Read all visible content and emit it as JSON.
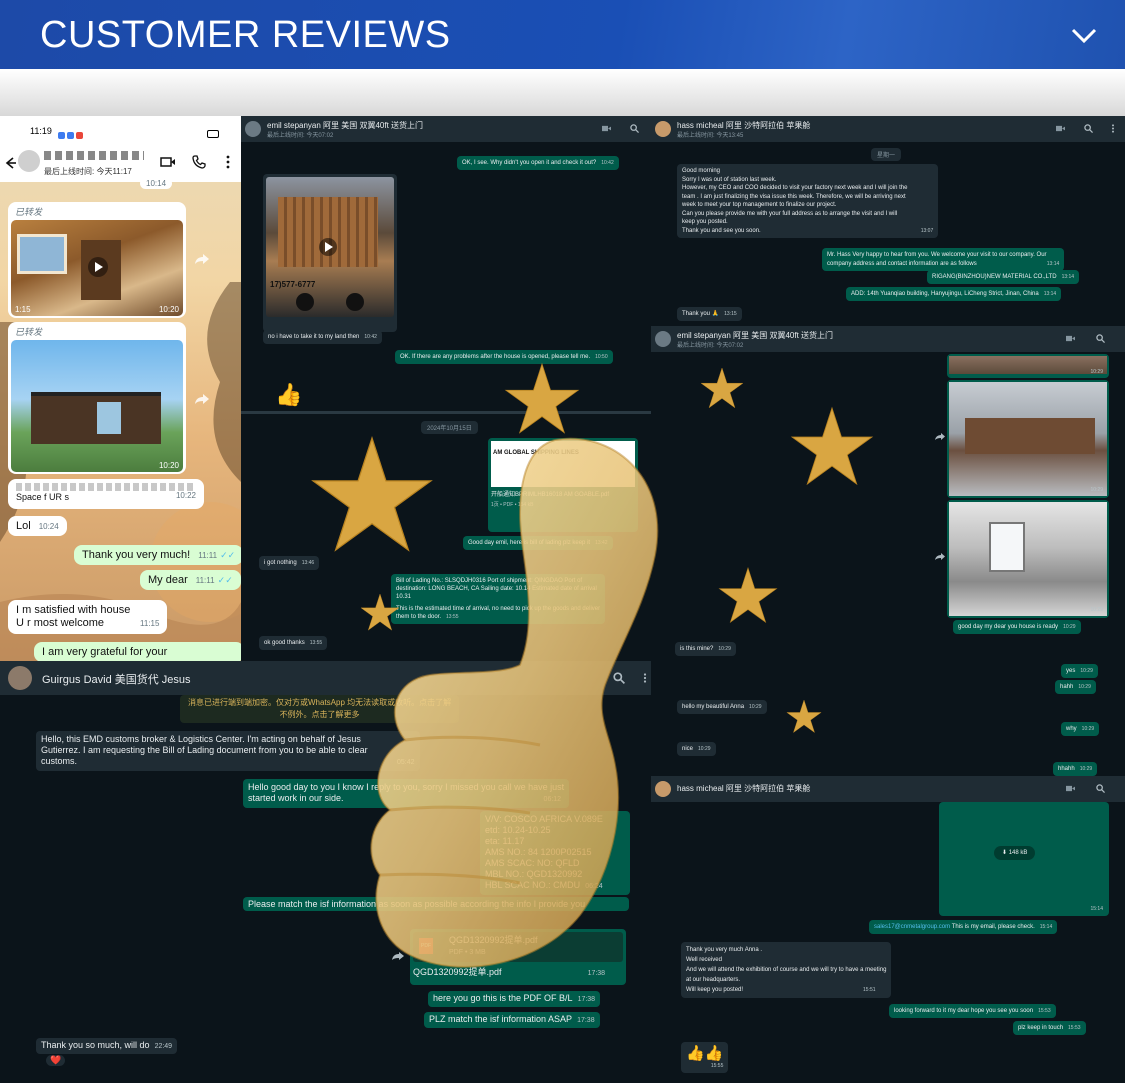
{
  "header": {
    "title": "CUSTOMER REVIEWS",
    "toggle_icon": "chevron-down-icon"
  },
  "phone": {
    "time": "11:19",
    "last_online": "最后上线时间: 今天11:17",
    "forwarded": "已转发",
    "video_duration": "1:15",
    "video_time": "10:20",
    "top_time": "10:14",
    "space_text": "Space f UR s",
    "space_time": "10:22",
    "msgs": [
      {
        "text": "Lol",
        "time": "10:24"
      },
      {
        "text": "Thank you very much!",
        "time": "11:11"
      },
      {
        "text": "My dear",
        "time": "11:11"
      },
      {
        "text": "I m  satisfied with house",
        "time": ""
      },
      {
        "text": "U r most welcome",
        "time": "11:15"
      },
      {
        "text": "I am very grateful for your",
        "time": ""
      }
    ]
  },
  "chat_emil1": {
    "name": "emil stepanyan 阿里 美国 双翼40ft 送货上门",
    "sub": "最后上线时间: 今天07:02",
    "msgs": [
      {
        "text": "OK, I see. Why didn't you open it and check it out?",
        "time": "10:42"
      },
      {
        "text": "no i have to take it to my land then",
        "time": "10:42"
      },
      {
        "text": "OK. If there are any problems after the house is opened, please tell me.",
        "time": "10:50"
      }
    ],
    "thumbs": "👍",
    "date": "2024年10月15日",
    "doc_header": "AM GLOBAL SHIPPING LINES",
    "doc_name": "开船通知BPRIMLHB16018 AM GOABLE.pdf",
    "doc_meta": "1页 • PDF • 154 kB",
    "msgs2": [
      {
        "text": "Good day emil, here is bill of lading plz keep it",
        "time": "13:42"
      },
      {
        "text": "i got nothing",
        "time": "13:46"
      },
      {
        "text": "Bill of Lading No.: SLSQDJH0316 Port of shipment: QINGDAO Port of",
        "time": ""
      },
      {
        "text": "destination: LONG BEACH, CA Sailing date: 10.14 Estimated date of arrival",
        "time": ""
      },
      {
        "text": "10.31",
        "time": ""
      },
      {
        "text": "This is the estimated time of arrival, no need to pick up the goods and deliver",
        "time": ""
      },
      {
        "text": "them to the door.",
        "time": "13:55"
      },
      {
        "text": "ok good thanks",
        "time": "13:55"
      }
    ],
    "video_phone": "17)577-6777"
  },
  "chat_hass1": {
    "name": "hass micheal 阿里 沙特阿拉伯 苹果舱",
    "sub": "最后上线时间: 今天13:45",
    "date": "星期一",
    "msgs": [
      {
        "text": "Good morning",
        "time": ""
      },
      {
        "text": "Sorry I was out of station last week.",
        "time": ""
      },
      {
        "text": "However, my CEO and COO decided to visit your factory next week and I will join the",
        "time": ""
      },
      {
        "text": "team . I am just finalizing the visa issue this week. Therefore, we will be arriving next",
        "time": ""
      },
      {
        "text": "week  to meet your top management to finalize our project.",
        "time": ""
      },
      {
        "text": "Can you please provide me with your full address as to arrange the visit and I will",
        "time": ""
      },
      {
        "text": "keep you posted.",
        "time": ""
      },
      {
        "text": "Thank you and see you soon.",
        "time": "13:07"
      }
    ],
    "replies": [
      {
        "text": "Mr. Hass Very happy to hear from you. We welcome your visit to our company. Our",
        "time": ""
      },
      {
        "text": "company address and contact information are as follows",
        "time": "13:14"
      },
      {
        "text": "RIGANG(BINZHOU)NEW MATERIAL CO.,LTD",
        "time": "13:14"
      },
      {
        "text": "ADD: 14th Yuanqiao building, Hanyujingu, LiCheng Strict, Jinan, China",
        "time": "13:14"
      }
    ],
    "thanks": {
      "text": "Thank you 🙏",
      "time": "13:15"
    }
  },
  "chat_emil2": {
    "name": "emil stepanyan 阿里 美国 双翼40ft 送货上门",
    "sub": "最后上线时间: 今天07:02",
    "photo_times": [
      "10:29",
      "10:29",
      "10:29"
    ],
    "msgs": [
      {
        "text": "good day my dear you house is ready",
        "time": "10:29",
        "dir": "out"
      },
      {
        "text": "is this mine?",
        "time": "10:29",
        "dir": "in"
      },
      {
        "text": "yes",
        "time": "10:29",
        "dir": "out"
      },
      {
        "text": "hahh",
        "time": "10:29",
        "dir": "out"
      },
      {
        "text": "hello my beautiful Anna",
        "time": "10:29",
        "dir": "in"
      },
      {
        "text": "why",
        "time": "10:29",
        "dir": "out"
      },
      {
        "text": "nice",
        "time": "10:29",
        "dir": "in"
      },
      {
        "text": "hhahh",
        "time": "10:29",
        "dir": "out"
      }
    ]
  },
  "chat_hass2": {
    "name": "hass micheal 阿里 沙特阿拉伯 苹果舱",
    "file_size": "148 kB",
    "file_time": "15:14",
    "email": "sales17@cnmetalgroup.com",
    "email_text": "This is my email, please check.",
    "email_time": "15:14",
    "msgs": [
      {
        "text": "Thank you very much Anna .",
        "time": ""
      },
      {
        "text": "Well received",
        "time": ""
      },
      {
        "text": "And we will attend the exhibition of course and we will try to have a meeting",
        "time": ""
      },
      {
        "text": "at our headquarters.",
        "time": ""
      },
      {
        "text": "Will keep you posted!",
        "time": "15:51"
      }
    ],
    "replies": [
      {
        "text": "looking forward to it my dear hope you see you soon",
        "time": "15:53"
      },
      {
        "text": "plz keep in touch",
        "time": "15:53"
      }
    ],
    "emoji": {
      "text": "👍👍",
      "time": "15:55"
    }
  },
  "chat_guirgus": {
    "name": "Guirgus David 美国货代 Jesus",
    "notice": "消息已进行端到端加密。仅对方或WhatsApp 均无法读取或收听。点击了解",
    "notice2": "不例外。点击了解更多",
    "msgs": [
      {
        "text": "Hello, this EMD customs broker & Logistics Center. I'm acting on behalf of Jesus",
        "time": ""
      },
      {
        "text": "Gutierrez. I am requesting the Bill of Lading document from you to be able to clear",
        "time": ""
      },
      {
        "text": "customs.",
        "time": "05:42"
      }
    ],
    "reply1": [
      {
        "text": "Hello good day to you I know   I reply to you, sorry I missed you call we have just",
        "time": ""
      },
      {
        "text": "started work in our side.",
        "time": "06:12"
      }
    ],
    "vessel": [
      "V/V: COSCO AFRICA V.089E",
      "etd:    10.24-10.25",
      "eta:    11.17",
      "AMS NO.: 84 1200P02515",
      "AMS SCAC: NO: QFLD",
      "MBL NO.: QGD1320992",
      "HBL SCAC NO.: CMDU"
    ],
    "vessel_time": "06:24",
    "match": "Please match the isf information as soon as possible according the info I provide you",
    "pdf_name": "QGD1320992提单.pdf",
    "pdf_meta": "PDF • 3 MB",
    "pdf_caption": "QGD1320992提单.pdf",
    "pdf_time": "17:38",
    "here": {
      "text": "here you go this is the PDF OF  B/L",
      "time": "17:38"
    },
    "plz": {
      "text": "PLZ match the isf information ASAP",
      "time": "17:38"
    },
    "thanks": {
      "text": "Thank you so much, will do",
      "time": "22:49"
    },
    "heart": "❤️"
  }
}
